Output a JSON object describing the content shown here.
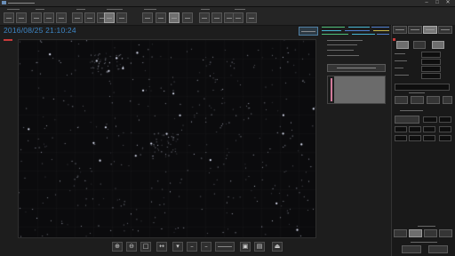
{
  "datetime": "2016/08/25 21:10:24",
  "colors": {
    "accent": "#3d86c6",
    "background": "#1d1d1d",
    "image_background": "#0b0b0d",
    "warning": "#c83a3a",
    "status_green": "#4fc07a",
    "status_cyan": "#46b6d2",
    "status_blue": "#4f7fd0",
    "status_yellow": "#c9b84a"
  },
  "icons": {
    "window": [
      "minimize-icon",
      "maximize-icon",
      "close-icon"
    ],
    "bottom_toolbar": [
      "zoom-in-icon",
      "zoom-out-icon",
      "fit-to-window-icon",
      "flip-icon",
      "dropdown-icon",
      "minus-icon",
      "minus-icon",
      "image-icon",
      "document-icon",
      "save-icon"
    ]
  }
}
